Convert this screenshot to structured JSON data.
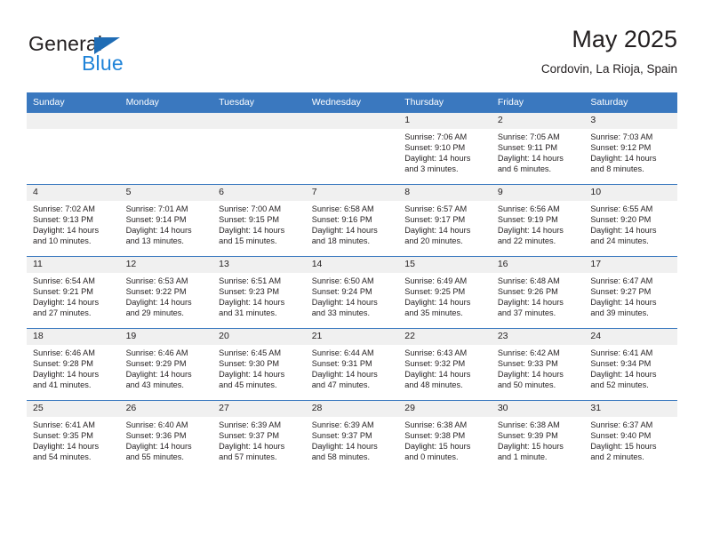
{
  "brand": {
    "name_part1": "General",
    "name_part2": "Blue"
  },
  "header": {
    "title": "May 2025",
    "subtitle": "Cordovin, La Rioja, Spain"
  },
  "colors": {
    "header_blue": "#3a78bf",
    "logo_blue": "#1f83d8",
    "logo_triangle": "#1f6cb5",
    "daynum_band": "#f0f0f0",
    "text": "#231f20"
  },
  "weekdays": [
    "Sunday",
    "Monday",
    "Tuesday",
    "Wednesday",
    "Thursday",
    "Friday",
    "Saturday"
  ],
  "labels": {
    "sunrise_prefix": "Sunrise:",
    "sunset_prefix": "Sunset:",
    "daylight_prefix": "Daylight:"
  },
  "weeks": [
    [
      {
        "empty": true
      },
      {
        "empty": true
      },
      {
        "empty": true
      },
      {
        "empty": true
      },
      {
        "day": "1",
        "sunrise": "Sunrise: 7:06 AM",
        "sunset": "Sunset: 9:10 PM",
        "daylight_l1": "Daylight: 14 hours",
        "daylight_l2": "and 3 minutes."
      },
      {
        "day": "2",
        "sunrise": "Sunrise: 7:05 AM",
        "sunset": "Sunset: 9:11 PM",
        "daylight_l1": "Daylight: 14 hours",
        "daylight_l2": "and 6 minutes."
      },
      {
        "day": "3",
        "sunrise": "Sunrise: 7:03 AM",
        "sunset": "Sunset: 9:12 PM",
        "daylight_l1": "Daylight: 14 hours",
        "daylight_l2": "and 8 minutes."
      }
    ],
    [
      {
        "day": "4",
        "sunrise": "Sunrise: 7:02 AM",
        "sunset": "Sunset: 9:13 PM",
        "daylight_l1": "Daylight: 14 hours",
        "daylight_l2": "and 10 minutes."
      },
      {
        "day": "5",
        "sunrise": "Sunrise: 7:01 AM",
        "sunset": "Sunset: 9:14 PM",
        "daylight_l1": "Daylight: 14 hours",
        "daylight_l2": "and 13 minutes."
      },
      {
        "day": "6",
        "sunrise": "Sunrise: 7:00 AM",
        "sunset": "Sunset: 9:15 PM",
        "daylight_l1": "Daylight: 14 hours",
        "daylight_l2": "and 15 minutes."
      },
      {
        "day": "7",
        "sunrise": "Sunrise: 6:58 AM",
        "sunset": "Sunset: 9:16 PM",
        "daylight_l1": "Daylight: 14 hours",
        "daylight_l2": "and 18 minutes."
      },
      {
        "day": "8",
        "sunrise": "Sunrise: 6:57 AM",
        "sunset": "Sunset: 9:17 PM",
        "daylight_l1": "Daylight: 14 hours",
        "daylight_l2": "and 20 minutes."
      },
      {
        "day": "9",
        "sunrise": "Sunrise: 6:56 AM",
        "sunset": "Sunset: 9:19 PM",
        "daylight_l1": "Daylight: 14 hours",
        "daylight_l2": "and 22 minutes."
      },
      {
        "day": "10",
        "sunrise": "Sunrise: 6:55 AM",
        "sunset": "Sunset: 9:20 PM",
        "daylight_l1": "Daylight: 14 hours",
        "daylight_l2": "and 24 minutes."
      }
    ],
    [
      {
        "day": "11",
        "sunrise": "Sunrise: 6:54 AM",
        "sunset": "Sunset: 9:21 PM",
        "daylight_l1": "Daylight: 14 hours",
        "daylight_l2": "and 27 minutes."
      },
      {
        "day": "12",
        "sunrise": "Sunrise: 6:53 AM",
        "sunset": "Sunset: 9:22 PM",
        "daylight_l1": "Daylight: 14 hours",
        "daylight_l2": "and 29 minutes."
      },
      {
        "day": "13",
        "sunrise": "Sunrise: 6:51 AM",
        "sunset": "Sunset: 9:23 PM",
        "daylight_l1": "Daylight: 14 hours",
        "daylight_l2": "and 31 minutes."
      },
      {
        "day": "14",
        "sunrise": "Sunrise: 6:50 AM",
        "sunset": "Sunset: 9:24 PM",
        "daylight_l1": "Daylight: 14 hours",
        "daylight_l2": "and 33 minutes."
      },
      {
        "day": "15",
        "sunrise": "Sunrise: 6:49 AM",
        "sunset": "Sunset: 9:25 PM",
        "daylight_l1": "Daylight: 14 hours",
        "daylight_l2": "and 35 minutes."
      },
      {
        "day": "16",
        "sunrise": "Sunrise: 6:48 AM",
        "sunset": "Sunset: 9:26 PM",
        "daylight_l1": "Daylight: 14 hours",
        "daylight_l2": "and 37 minutes."
      },
      {
        "day": "17",
        "sunrise": "Sunrise: 6:47 AM",
        "sunset": "Sunset: 9:27 PM",
        "daylight_l1": "Daylight: 14 hours",
        "daylight_l2": "and 39 minutes."
      }
    ],
    [
      {
        "day": "18",
        "sunrise": "Sunrise: 6:46 AM",
        "sunset": "Sunset: 9:28 PM",
        "daylight_l1": "Daylight: 14 hours",
        "daylight_l2": "and 41 minutes."
      },
      {
        "day": "19",
        "sunrise": "Sunrise: 6:46 AM",
        "sunset": "Sunset: 9:29 PM",
        "daylight_l1": "Daylight: 14 hours",
        "daylight_l2": "and 43 minutes."
      },
      {
        "day": "20",
        "sunrise": "Sunrise: 6:45 AM",
        "sunset": "Sunset: 9:30 PM",
        "daylight_l1": "Daylight: 14 hours",
        "daylight_l2": "and 45 minutes."
      },
      {
        "day": "21",
        "sunrise": "Sunrise: 6:44 AM",
        "sunset": "Sunset: 9:31 PM",
        "daylight_l1": "Daylight: 14 hours",
        "daylight_l2": "and 47 minutes."
      },
      {
        "day": "22",
        "sunrise": "Sunrise: 6:43 AM",
        "sunset": "Sunset: 9:32 PM",
        "daylight_l1": "Daylight: 14 hours",
        "daylight_l2": "and 48 minutes."
      },
      {
        "day": "23",
        "sunrise": "Sunrise: 6:42 AM",
        "sunset": "Sunset: 9:33 PM",
        "daylight_l1": "Daylight: 14 hours",
        "daylight_l2": "and 50 minutes."
      },
      {
        "day": "24",
        "sunrise": "Sunrise: 6:41 AM",
        "sunset": "Sunset: 9:34 PM",
        "daylight_l1": "Daylight: 14 hours",
        "daylight_l2": "and 52 minutes."
      }
    ],
    [
      {
        "day": "25",
        "sunrise": "Sunrise: 6:41 AM",
        "sunset": "Sunset: 9:35 PM",
        "daylight_l1": "Daylight: 14 hours",
        "daylight_l2": "and 54 minutes."
      },
      {
        "day": "26",
        "sunrise": "Sunrise: 6:40 AM",
        "sunset": "Sunset: 9:36 PM",
        "daylight_l1": "Daylight: 14 hours",
        "daylight_l2": "and 55 minutes."
      },
      {
        "day": "27",
        "sunrise": "Sunrise: 6:39 AM",
        "sunset": "Sunset: 9:37 PM",
        "daylight_l1": "Daylight: 14 hours",
        "daylight_l2": "and 57 minutes."
      },
      {
        "day": "28",
        "sunrise": "Sunrise: 6:39 AM",
        "sunset": "Sunset: 9:37 PM",
        "daylight_l1": "Daylight: 14 hours",
        "daylight_l2": "and 58 minutes."
      },
      {
        "day": "29",
        "sunrise": "Sunrise: 6:38 AM",
        "sunset": "Sunset: 9:38 PM",
        "daylight_l1": "Daylight: 15 hours",
        "daylight_l2": "and 0 minutes."
      },
      {
        "day": "30",
        "sunrise": "Sunrise: 6:38 AM",
        "sunset": "Sunset: 9:39 PM",
        "daylight_l1": "Daylight: 15 hours",
        "daylight_l2": "and 1 minute."
      },
      {
        "day": "31",
        "sunrise": "Sunrise: 6:37 AM",
        "sunset": "Sunset: 9:40 PM",
        "daylight_l1": "Daylight: 15 hours",
        "daylight_l2": "and 2 minutes."
      }
    ]
  ]
}
